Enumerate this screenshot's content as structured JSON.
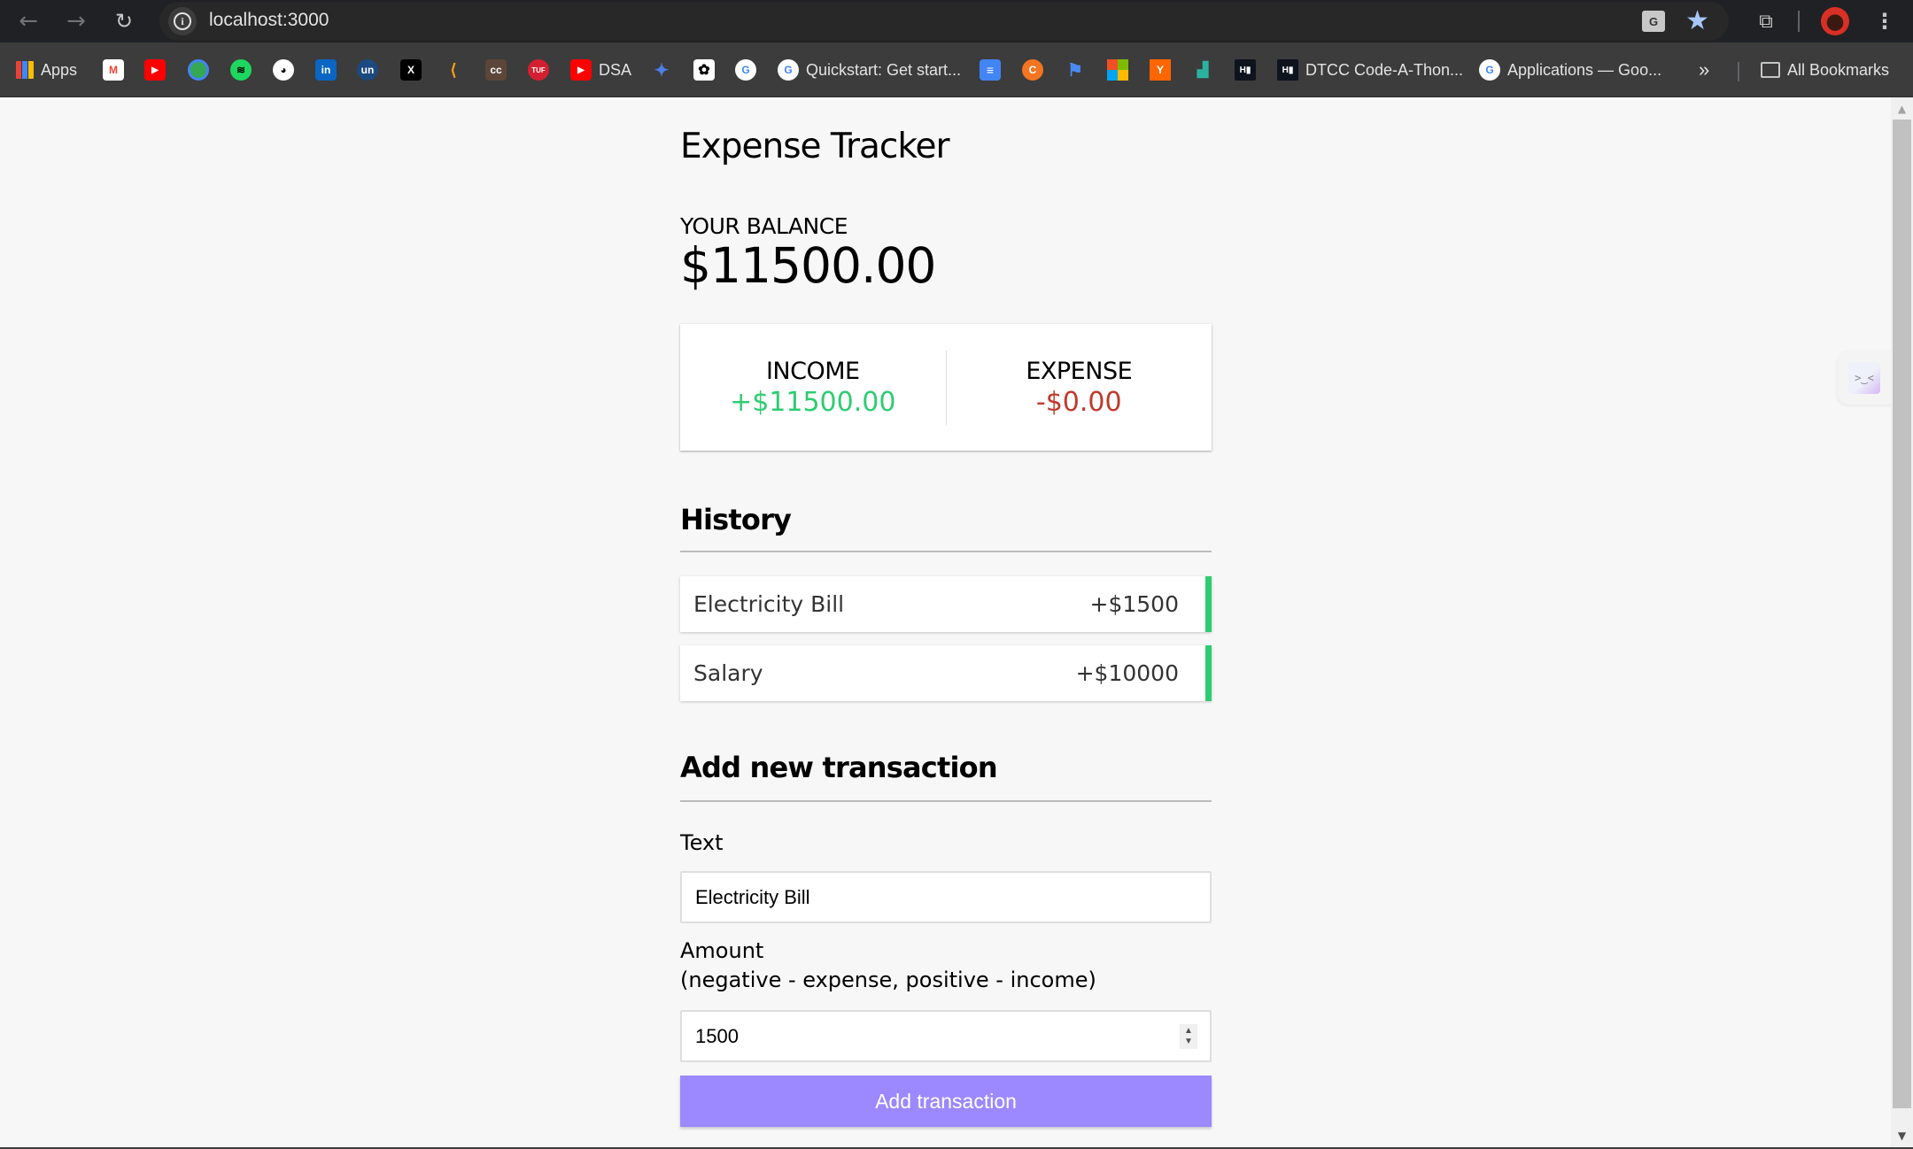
{
  "browser": {
    "url": "localhost:3000",
    "nav": {
      "back_icon": "←",
      "forward_icon": "→",
      "reload_icon": "↻"
    },
    "translate_label": "G",
    "star_icon": "★",
    "extensions_icon": "⧉",
    "menu_icon": "⋮"
  },
  "bookmarks": {
    "items": [
      {
        "label": "Apps",
        "icon": "apps-grid"
      },
      {
        "label": "",
        "icon": "gmail"
      },
      {
        "label": "",
        "icon": "youtube"
      },
      {
        "label": "",
        "icon": "google-maps"
      },
      {
        "label": "",
        "icon": "spotify"
      },
      {
        "label": "",
        "icon": "github"
      },
      {
        "label": "",
        "icon": "linkedin"
      },
      {
        "label": "",
        "icon": "unstop"
      },
      {
        "label": "",
        "icon": "x-twitter"
      },
      {
        "label": "",
        "icon": "leetcode"
      },
      {
        "label": "",
        "icon": "codechef"
      },
      {
        "label": "",
        "icon": "takeuforward"
      },
      {
        "label": "DSA",
        "icon": "youtube"
      },
      {
        "label": "",
        "icon": "gemini"
      },
      {
        "label": "",
        "icon": "chatgpt"
      },
      {
        "label": "",
        "icon": "google"
      },
      {
        "label": "Quickstart: Get start...",
        "icon": "google"
      },
      {
        "label": "",
        "icon": "google-docs"
      },
      {
        "label": "",
        "icon": "crunchyroll"
      },
      {
        "label": "",
        "icon": "flag"
      },
      {
        "label": "",
        "icon": "microsoft"
      },
      {
        "label": "",
        "icon": "ycombinator"
      },
      {
        "label": "",
        "icon": "chart-app"
      },
      {
        "label": "",
        "icon": "hackerrank"
      },
      {
        "label": "DTCC Code-A-Thon...",
        "icon": "hackerrank"
      },
      {
        "label": "Applications — Goo...",
        "icon": "google"
      }
    ],
    "overflow_icon": "»",
    "all_bookmarks_label": "All Bookmarks"
  },
  "app": {
    "title": "Expense Tracker",
    "balance_label": "YOUR BALANCE",
    "balance_value": "$11500.00",
    "income_label": "INCOME",
    "income_value": "+$11500.00",
    "expense_label": "EXPENSE",
    "expense_value": "-$0.00",
    "history_heading": "History",
    "transactions": [
      {
        "text": "Electricity Bill",
        "amount": "+$1500",
        "type": "plus"
      },
      {
        "text": "Salary",
        "amount": "+$10000",
        "type": "plus"
      }
    ],
    "add_heading": "Add new transaction",
    "text_label": "Text",
    "text_value": "Electricity Bill",
    "amount_label": "Amount",
    "amount_hint": "(negative - expense, positive - income)",
    "amount_value": "1500",
    "submit_label": "Add transaction"
  },
  "colors": {
    "income": "#2ecc71",
    "expense": "#c0392b",
    "accent": "#9c88ff"
  },
  "side_widget": {
    "icon": ">‿<"
  }
}
